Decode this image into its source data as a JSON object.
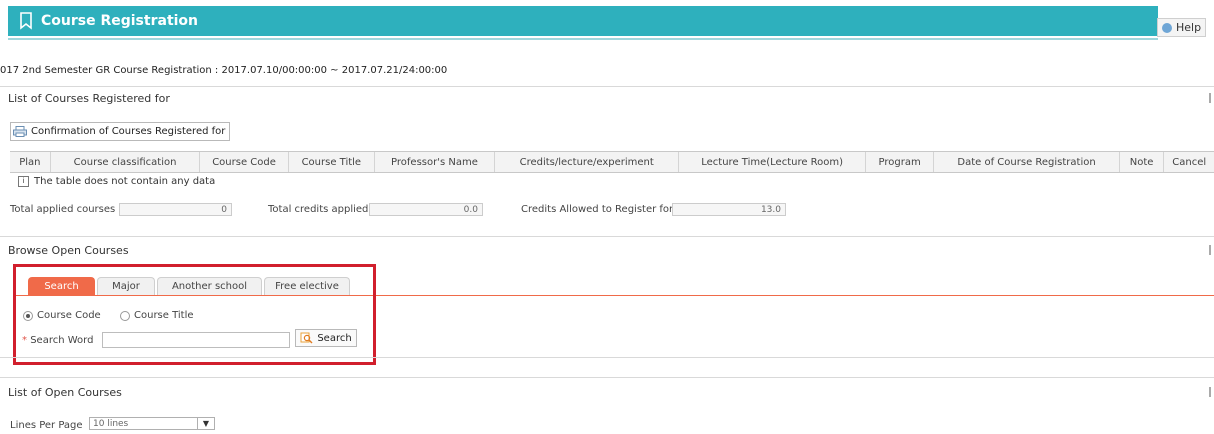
{
  "header": {
    "title": "Course Registration",
    "help_label": "Help"
  },
  "period_text": "017 2nd Semester GR Course Registration : 2017.07.10/00:00:00  ~  2017.07.21/24:00:00",
  "registered": {
    "heading": "List of Courses Registered for",
    "confirm_label": "Confirmation of Courses Registered for",
    "columns": [
      "Plan",
      "Course classification",
      "Course Code",
      "Course Title",
      "Professor's Name",
      "Credits/lecture/experiment",
      "Lecture Time(Lecture Room)",
      "Program",
      "Date of Course Registration",
      "Note",
      "Cancel"
    ],
    "no_data": "The table does not contain any data",
    "totals": {
      "courses_label": "Total applied courses",
      "courses_value": "0",
      "credits_label": "Total credits applied",
      "credits_value": "0.0",
      "allowed_label": "Credits Allowed to Register for",
      "allowed_value": "13.0"
    }
  },
  "browse": {
    "heading": "Browse Open Courses",
    "tabs": [
      "Search",
      "Major",
      "Another school",
      "Free elective"
    ],
    "radio_options": [
      "Course Code",
      "Course Title"
    ],
    "search_word_label": "Search Word",
    "search_value": "",
    "search_button": "Search"
  },
  "open_courses": {
    "heading": "List of Open Courses",
    "lines_label": "Lines Per Page",
    "lines_value": "10 lines"
  },
  "colors": {
    "header_bg": "#2eb0bd",
    "tab_active": "#f06a49",
    "highlight": "#d11f2d"
  }
}
